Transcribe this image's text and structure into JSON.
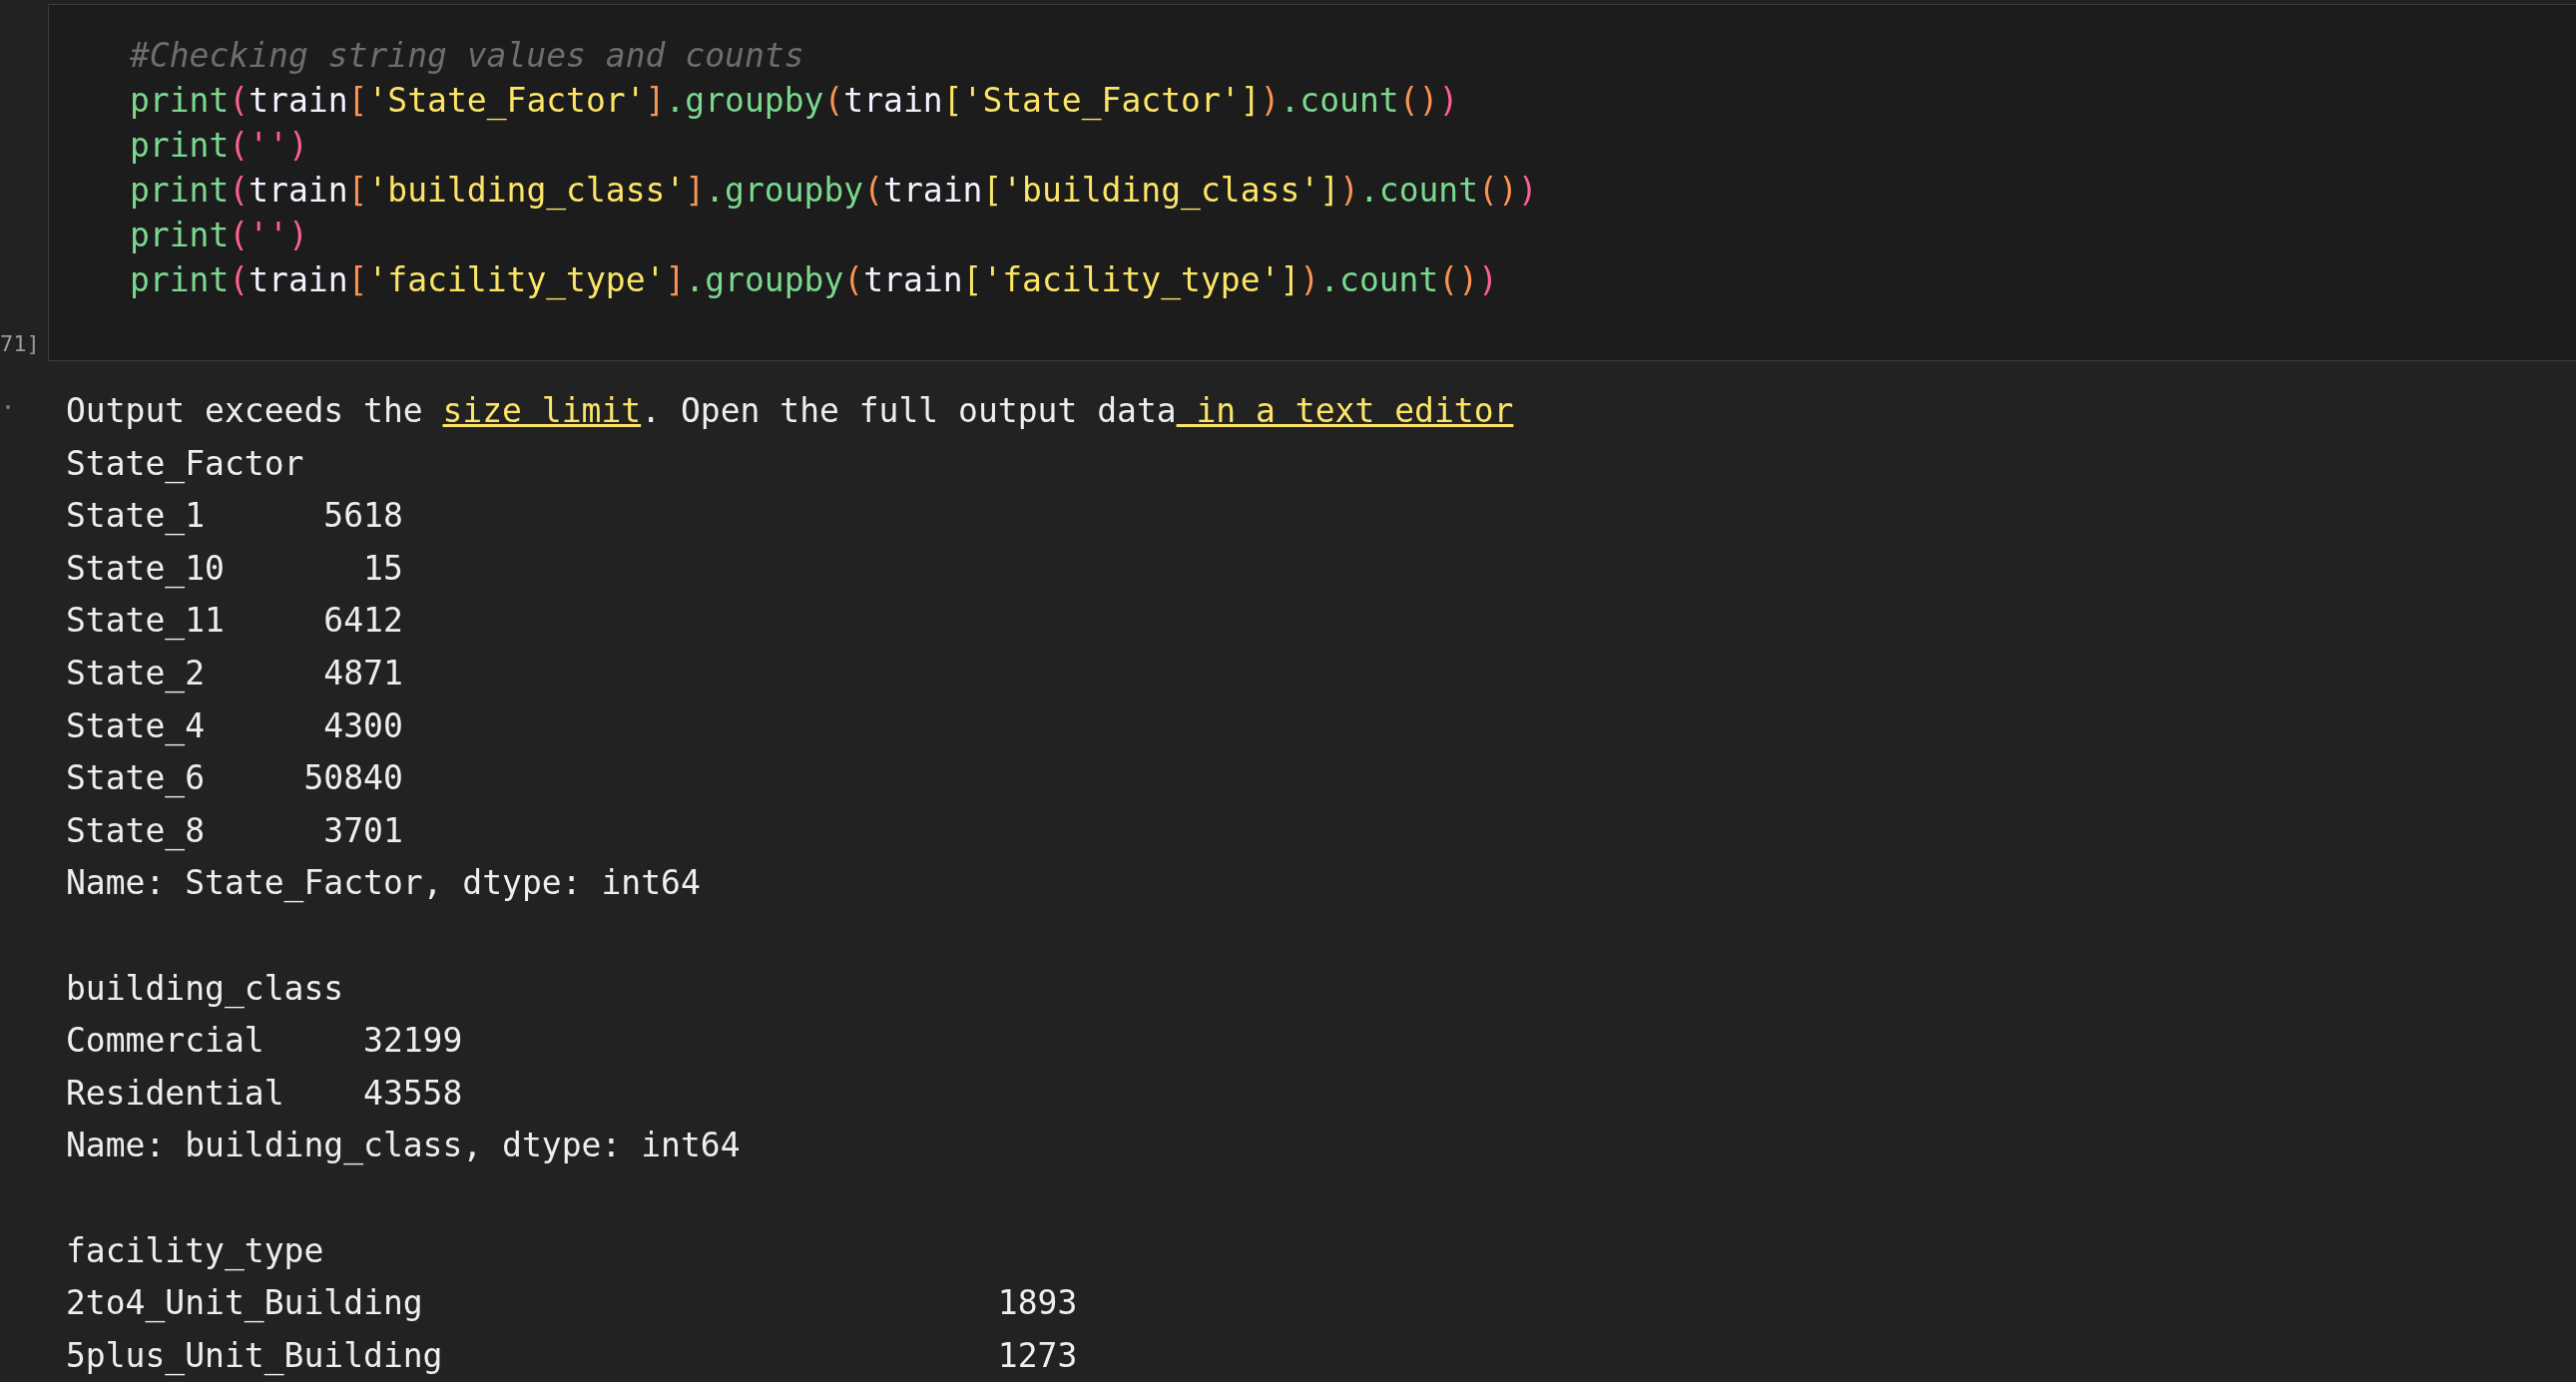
{
  "cell": {
    "execution_count": "71]",
    "code": [
      [
        {
          "kind": "comment",
          "text": "#Checking string values and counts"
        }
      ],
      [
        {
          "kind": "func",
          "text": "print"
        },
        {
          "kind": "p1",
          "text": "("
        },
        {
          "kind": "plain",
          "text": "train"
        },
        {
          "kind": "p2",
          "text": "["
        },
        {
          "kind": "string",
          "text": "'State_Factor'"
        },
        {
          "kind": "p2",
          "text": "]"
        },
        {
          "kind": "func",
          "text": ".groupby"
        },
        {
          "kind": "p2",
          "text": "("
        },
        {
          "kind": "plain",
          "text": "train"
        },
        {
          "kind": "p3",
          "text": "["
        },
        {
          "kind": "string",
          "text": "'State_Factor'"
        },
        {
          "kind": "p3",
          "text": "]"
        },
        {
          "kind": "p2",
          "text": ")"
        },
        {
          "kind": "func",
          "text": ".count"
        },
        {
          "kind": "p2",
          "text": "()"
        },
        {
          "kind": "p1",
          "text": ")"
        }
      ],
      [
        {
          "kind": "func",
          "text": "print"
        },
        {
          "kind": "p1",
          "text": "('')"
        }
      ],
      [
        {
          "kind": "func",
          "text": "print"
        },
        {
          "kind": "p1",
          "text": "("
        },
        {
          "kind": "plain",
          "text": "train"
        },
        {
          "kind": "p2",
          "text": "["
        },
        {
          "kind": "string",
          "text": "'building_class'"
        },
        {
          "kind": "p2",
          "text": "]"
        },
        {
          "kind": "func",
          "text": ".groupby"
        },
        {
          "kind": "p2",
          "text": "("
        },
        {
          "kind": "plain",
          "text": "train"
        },
        {
          "kind": "p3",
          "text": "["
        },
        {
          "kind": "string",
          "text": "'building_class'"
        },
        {
          "kind": "p3",
          "text": "]"
        },
        {
          "kind": "p2",
          "text": ")"
        },
        {
          "kind": "func",
          "text": ".count"
        },
        {
          "kind": "p2",
          "text": "()"
        },
        {
          "kind": "p1",
          "text": ")"
        }
      ],
      [
        {
          "kind": "func",
          "text": "print"
        },
        {
          "kind": "p1",
          "text": "('')"
        }
      ],
      [
        {
          "kind": "func",
          "text": "print"
        },
        {
          "kind": "p1",
          "text": "("
        },
        {
          "kind": "plain",
          "text": "train"
        },
        {
          "kind": "p2",
          "text": "["
        },
        {
          "kind": "string",
          "text": "'facility_type'"
        },
        {
          "kind": "p2",
          "text": "]"
        },
        {
          "kind": "func",
          "text": ".groupby"
        },
        {
          "kind": "p2",
          "text": "("
        },
        {
          "kind": "plain",
          "text": "train"
        },
        {
          "kind": "p3",
          "text": "["
        },
        {
          "kind": "string",
          "text": "'facility_type'"
        },
        {
          "kind": "p3",
          "text": "]"
        },
        {
          "kind": "p2",
          "text": ")"
        },
        {
          "kind": "func",
          "text": ".count"
        },
        {
          "kind": "p2",
          "text": "()"
        },
        {
          "kind": "p1",
          "text": ")"
        }
      ]
    ]
  },
  "output": {
    "notice": [
      {
        "text": "Output exceeds the ",
        "link": false
      },
      {
        "text": "size limit",
        "link": true
      },
      {
        "text": ". Open the full output data",
        "link": false
      },
      {
        "text": " in a text editor",
        "link": true
      }
    ],
    "blocks": [
      {
        "lines": [
          "State_Factor",
          "State_1      5618",
          "State_10       15",
          "State_11     6412",
          "State_2      4871",
          "State_4      4300",
          "State_6     50840",
          "State_8      3701",
          "Name: State_Factor, dtype: int64"
        ]
      },
      {
        "lines": [
          "building_class",
          "Commercial     32199",
          "Residential    43558",
          "Name: building_class, dtype: int64"
        ]
      },
      {
        "lines": [
          "facility_type",
          "2to4_Unit_Building                             1893",
          "5plus_Unit_Building                            1273"
        ]
      }
    ]
  }
}
